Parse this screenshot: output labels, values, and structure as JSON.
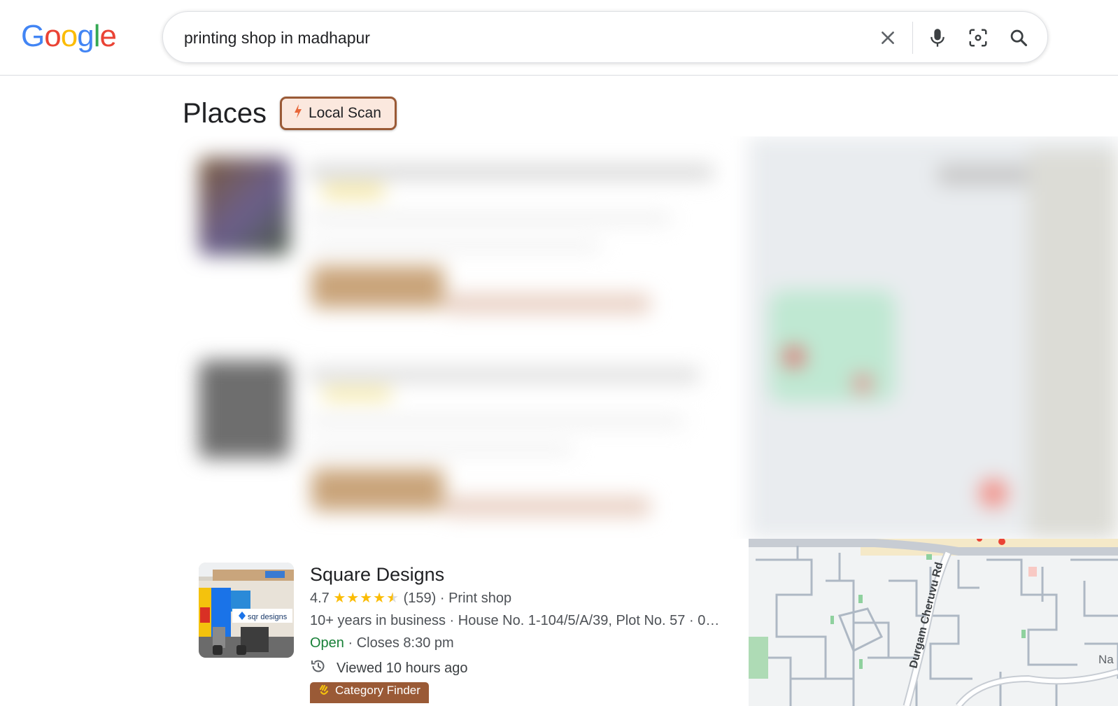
{
  "logo": {
    "letters": [
      "G",
      "o",
      "o",
      "g",
      "l",
      "e"
    ],
    "colors": [
      "#4285f4",
      "#ea4335",
      "#fbbc05",
      "#4285f4",
      "#34a853",
      "#ea4335"
    ]
  },
  "search": {
    "query": "printing shop in madhapur",
    "clear_icon": "close-icon",
    "voice_icon": "microphone-icon",
    "lens_icon": "camera-lens-icon",
    "search_icon": "search-icon"
  },
  "places": {
    "title": "Places",
    "local_scan_label": "Local Scan",
    "local_scan_icon": "lightning-bolt-icon"
  },
  "result": {
    "name": "Square Designs",
    "rating": "4.7",
    "stars": "★★★★",
    "half_star": "★",
    "reviews": "(159)",
    "category": "· Print shop",
    "details": "10+ years in business · House No. 1-104/5/A/39, Plot No. 57 · 0…",
    "open_status": "Open",
    "closes": "· Closes 8:30 pm",
    "viewed": "Viewed 10 hours ago",
    "badge": "Category Finder",
    "photo_sign": "sqr designs"
  },
  "map": {
    "road_label": "Durgam Cheruvu Rd",
    "edge_label": "Na"
  },
  "colors": {
    "accent_brown": "#9a5a36",
    "local_scan_bg": "#fbe8de",
    "open_green": "#188038",
    "star_yellow": "#fbbc04"
  }
}
